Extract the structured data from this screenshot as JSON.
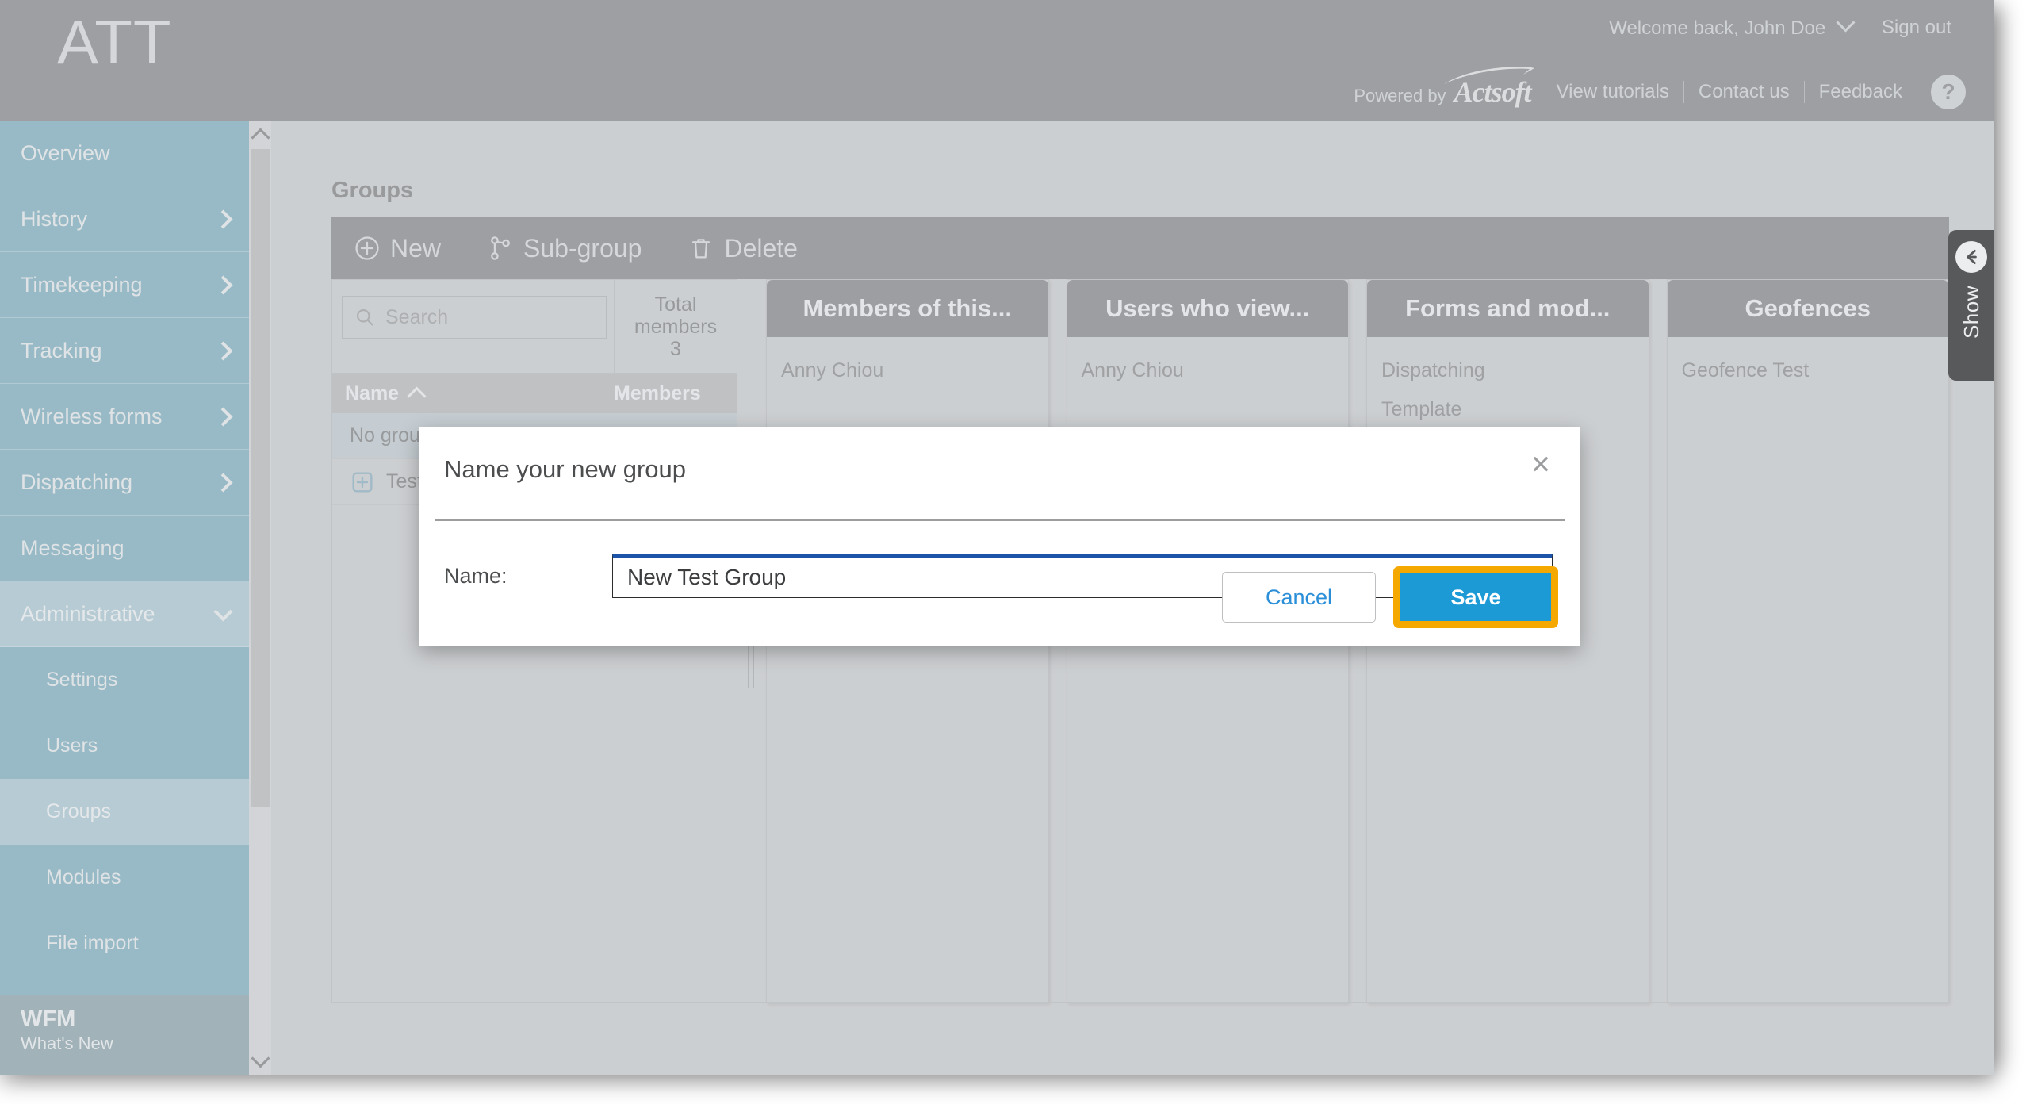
{
  "header": {
    "logo": "ATT",
    "welcome": "Welcome back, John Doe",
    "sign_out": "Sign out",
    "powered_by": "Powered by",
    "brand": "Actsoft",
    "view_tutorials": "View tutorials",
    "contact_us": "Contact us",
    "feedback": "Feedback",
    "help": "?"
  },
  "sidebar": {
    "items": [
      {
        "label": "Overview",
        "caret": false,
        "active": false,
        "sub": false
      },
      {
        "label": "History",
        "caret": true,
        "active": false,
        "sub": false
      },
      {
        "label": "Timekeeping",
        "caret": true,
        "active": false,
        "sub": false
      },
      {
        "label": "Tracking",
        "caret": true,
        "active": false,
        "sub": false
      },
      {
        "label": "Wireless forms",
        "caret": true,
        "active": false,
        "sub": false
      },
      {
        "label": "Dispatching",
        "caret": true,
        "active": false,
        "sub": false
      },
      {
        "label": "Messaging",
        "caret": false,
        "active": false,
        "sub": false
      },
      {
        "label": "Administrative",
        "caret": true,
        "active": true,
        "sub": false,
        "expanded": true
      },
      {
        "label": "Settings",
        "caret": false,
        "active": false,
        "sub": true
      },
      {
        "label": "Users",
        "caret": false,
        "active": false,
        "sub": true
      },
      {
        "label": "Groups",
        "caret": false,
        "active": true,
        "sub": true
      },
      {
        "label": "Modules",
        "caret": false,
        "active": false,
        "sub": true
      },
      {
        "label": "File import",
        "caret": false,
        "active": false,
        "sub": true
      }
    ],
    "footer_title": "WFM",
    "footer_sub": "What's New"
  },
  "page": {
    "title": "Groups"
  },
  "toolbar": {
    "new_label": "New",
    "subgroup_label": "Sub-group",
    "delete_label": "Delete"
  },
  "grid": {
    "search_placeholder": "Search",
    "search_value": "",
    "total_members_label": "Total\nmembers",
    "total_members_line1": "Total",
    "total_members_line2": "members",
    "total_members_count": "3",
    "columns": [
      "Name",
      "Members"
    ],
    "sort_column": "Name",
    "sort_direction": "asc",
    "rows": [
      {
        "name": "No group",
        "members": "",
        "selected": true,
        "expandable": false
      },
      {
        "name": "Test group",
        "members": "",
        "selected": false,
        "expandable": true
      }
    ]
  },
  "panels": [
    {
      "title": "Members of this...",
      "items": [
        "Anny Chiou"
      ]
    },
    {
      "title": "Users who view...",
      "items": [
        "Anny Chiou"
      ]
    },
    {
      "title": "Forms and mod...",
      "items": [
        "Dispatching",
        "Template"
      ]
    },
    {
      "title": "Geofences",
      "items": [
        "Geofence Test"
      ]
    }
  ],
  "show_tab": {
    "label": "Show"
  },
  "modal": {
    "title": "Name your new group",
    "close": "×",
    "name_label": "Name:",
    "name_value": "New Test Group",
    "cancel_label": "Cancel",
    "save_label": "Save"
  },
  "colors": {
    "header_bg": "#78797c",
    "sidebar_bg": "#6fa8ba",
    "sidebar_active": "#a3c4d0",
    "content_bg": "#c9cbcd",
    "panel_head_bg": "#76787b",
    "save_blue": "#1b9ad6",
    "focus_orange": "#f5a800",
    "input_focus_blue": "#1b54a8",
    "link_blue": "#2a8fd8"
  }
}
